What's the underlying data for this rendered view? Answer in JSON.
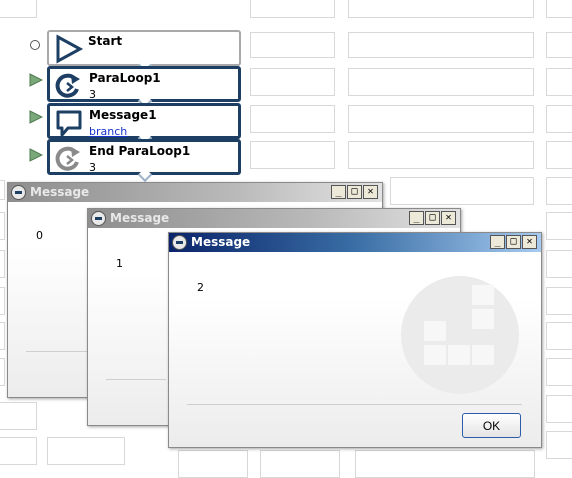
{
  "flow": {
    "steps": [
      {
        "title": "Start",
        "sub": "",
        "icon": "play-triangle-icon"
      },
      {
        "title": "ParaLoop1",
        "sub": "3",
        "icon": "loop-icon"
      },
      {
        "title": "Message1",
        "sub": "branch",
        "icon": "speech-bubble-icon"
      },
      {
        "title": "End ParaLoop1",
        "sub": "3",
        "icon": "end-loop-icon"
      }
    ]
  },
  "windows": [
    {
      "title": "Message",
      "text": "0"
    },
    {
      "title": "Message",
      "text": "1"
    },
    {
      "title": "Message",
      "text": "2",
      "ok_label": "OK"
    }
  ],
  "titlebar_buttons": {
    "minimize": "_",
    "maximize": "□",
    "close": "✕"
  },
  "colors": {
    "step_border": "#1d3f63",
    "pointer": "#7ba87b",
    "link": "#1a33cc",
    "active_title": "#0a246a"
  }
}
